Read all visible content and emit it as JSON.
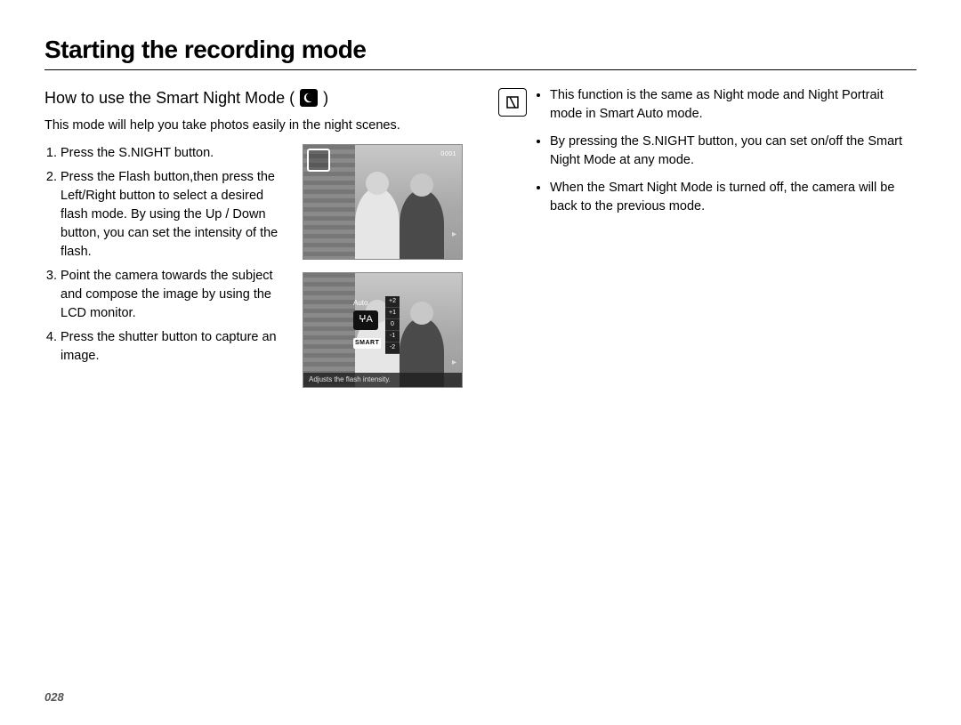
{
  "title": "Starting the recording mode",
  "subtitle_prefix": "How to use the Smart Night Mode ( ",
  "subtitle_suffix": " )",
  "intro": "This mode will help you take photos easily in the night scenes.",
  "steps": [
    "Press the S.NIGHT button.",
    "Press the Flash button,then press the Left/Right button to select a desired flash mode. By using the Up / Down button, you can set the intensity of the flash.",
    "Point the camera towards the subject and compose the image by using the LCD monitor.",
    "Press the shutter button to capture an image."
  ],
  "thumb1": {
    "top_right": "0001"
  },
  "thumb2": {
    "menu_auto": "Auto",
    "menu_flash": "ⵖA",
    "menu_smart": "SMART",
    "scale": [
      "+2",
      "+1",
      "0",
      "-1",
      "-2"
    ],
    "caption": "Adjusts the flash intensity."
  },
  "notes": [
    "This function is the same as Night mode and Night Portrait mode in Smart Auto mode.",
    "By pressing the S.NIGHT button, you can set on/off the Smart Night Mode at any mode.",
    "When the Smart Night Mode is turned off, the camera will be back to the previous mode."
  ],
  "page_number": "028"
}
